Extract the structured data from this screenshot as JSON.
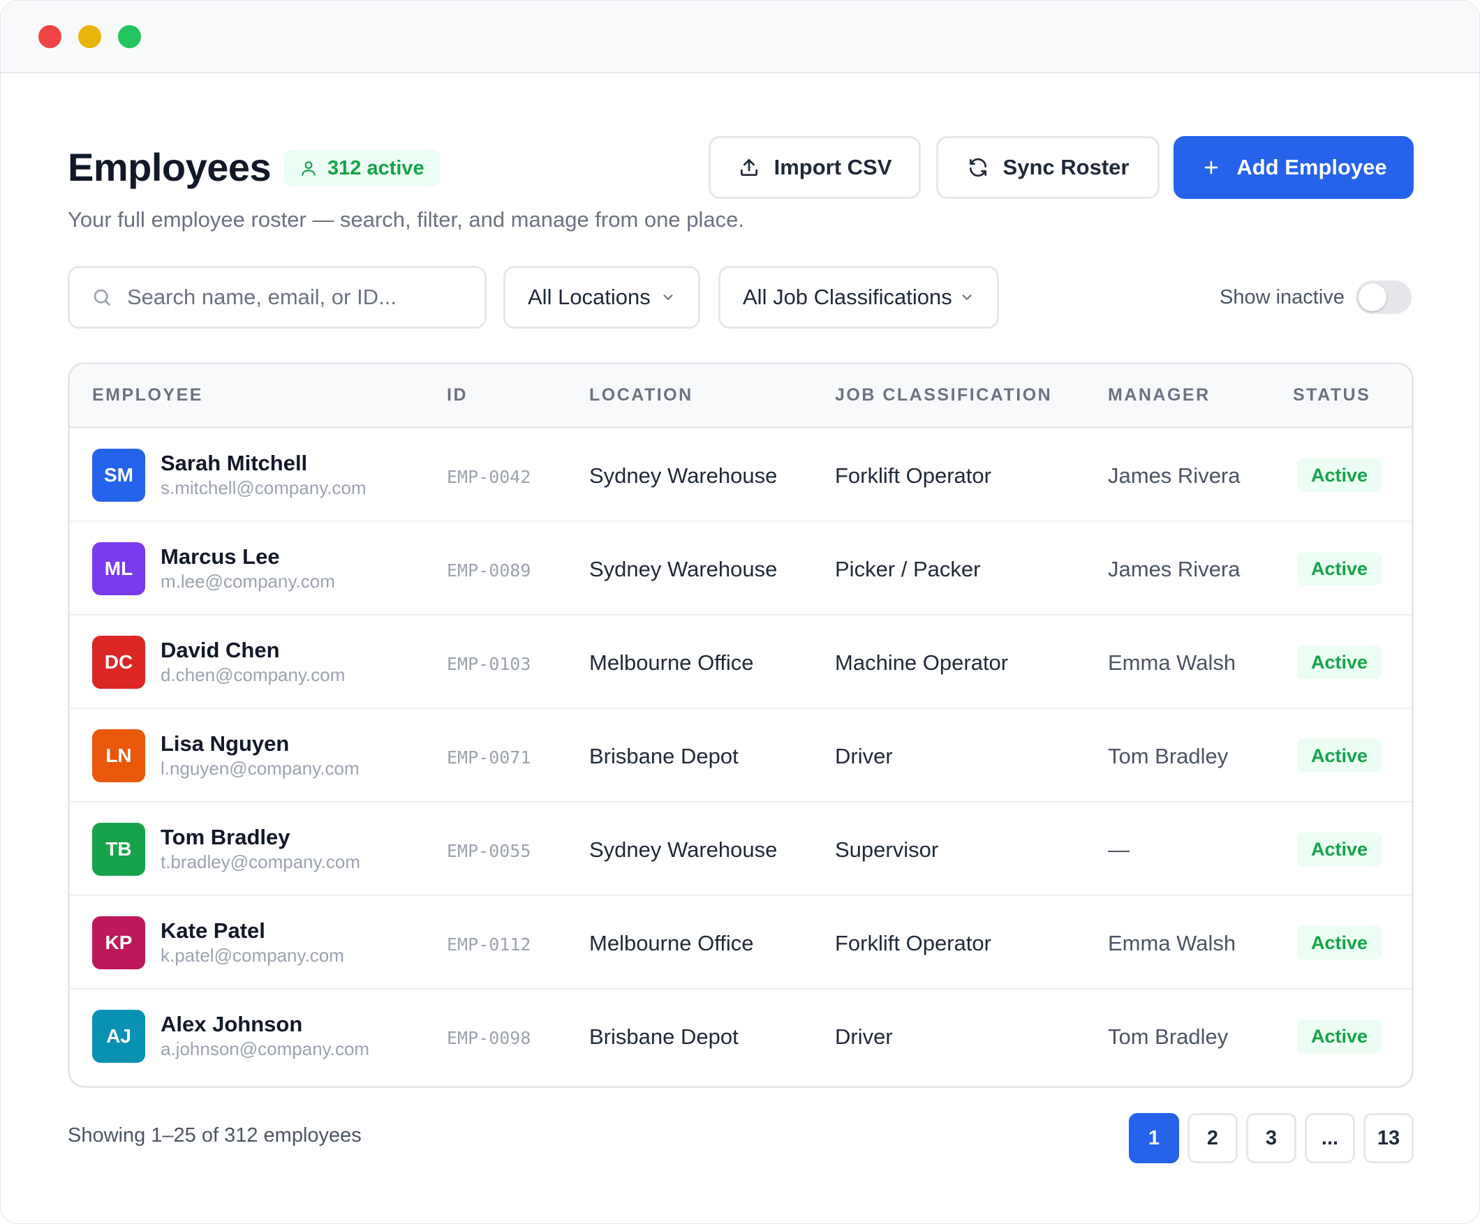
{
  "header": {
    "title": "Employees",
    "active_count": "312 active",
    "subtitle": "Your full employee roster — search, filter, and manage from one place.",
    "import_label": "Import CSV",
    "sync_label": "Sync Roster",
    "add_label": "Add Employee"
  },
  "filters": {
    "search_placeholder": "Search name, email, or ID...",
    "location": "All Locations",
    "job_classification": "All Job Classifications",
    "show_inactive_label": "Show inactive",
    "show_inactive": false
  },
  "table": {
    "columns": [
      "EMPLOYEE",
      "ID",
      "LOCATION",
      "JOB CLASSIFICATION",
      "MANAGER",
      "STATUS"
    ],
    "rows": [
      {
        "initials": "SM",
        "avatar_color": "#2563eb",
        "name": "Sarah Mitchell",
        "email": "s.mitchell@company.com",
        "id": "EMP-0042",
        "location": "Sydney Warehouse",
        "job": "Forklift Operator",
        "manager": "James Rivera",
        "status": "Active"
      },
      {
        "initials": "ML",
        "avatar_color": "#7c3aed",
        "name": "Marcus Lee",
        "email": "m.lee@company.com",
        "id": "EMP-0089",
        "location": "Sydney Warehouse",
        "job": "Picker / Packer",
        "manager": "James Rivera",
        "status": "Active"
      },
      {
        "initials": "DC",
        "avatar_color": "#dc2626",
        "name": "David Chen",
        "email": "d.chen@company.com",
        "id": "EMP-0103",
        "location": "Melbourne Office",
        "job": "Machine Operator",
        "manager": "Emma Walsh",
        "status": "Active"
      },
      {
        "initials": "LN",
        "avatar_color": "#ea580c",
        "name": "Lisa Nguyen",
        "email": "l.nguyen@company.com",
        "id": "EMP-0071",
        "location": "Brisbane Depot",
        "job": "Driver",
        "manager": "Tom Bradley",
        "status": "Active"
      },
      {
        "initials": "TB",
        "avatar_color": "#16a34a",
        "name": "Tom Bradley",
        "email": "t.bradley@company.com",
        "id": "EMP-0055",
        "location": "Sydney Warehouse",
        "job": "Supervisor",
        "manager": "—",
        "status": "Active"
      },
      {
        "initials": "KP",
        "avatar_color": "#be185d",
        "name": "Kate Patel",
        "email": "k.patel@company.com",
        "id": "EMP-0112",
        "location": "Melbourne Office",
        "job": "Forklift Operator",
        "manager": "Emma Walsh",
        "status": "Active"
      },
      {
        "initials": "AJ",
        "avatar_color": "#0891b2",
        "name": "Alex Johnson",
        "email": "a.johnson@company.com",
        "id": "EMP-0098",
        "location": "Brisbane Depot",
        "job": "Driver",
        "manager": "Tom Bradley",
        "status": "Active"
      }
    ]
  },
  "footer": {
    "showing": "Showing 1–25 of 312 employees",
    "pages": [
      "1",
      "2",
      "3",
      "...",
      "13"
    ],
    "current_page": "1"
  },
  "colors": {
    "accent": "#2563eb",
    "success": "#16a34a",
    "success_bg": "#ecfdf3"
  },
  "icons": {
    "active_pill": "user-icon",
    "import": "upload-icon",
    "sync": "refresh-icon",
    "add": "plus-icon",
    "search": "search-icon",
    "dropdown": "chevron-down-icon"
  }
}
